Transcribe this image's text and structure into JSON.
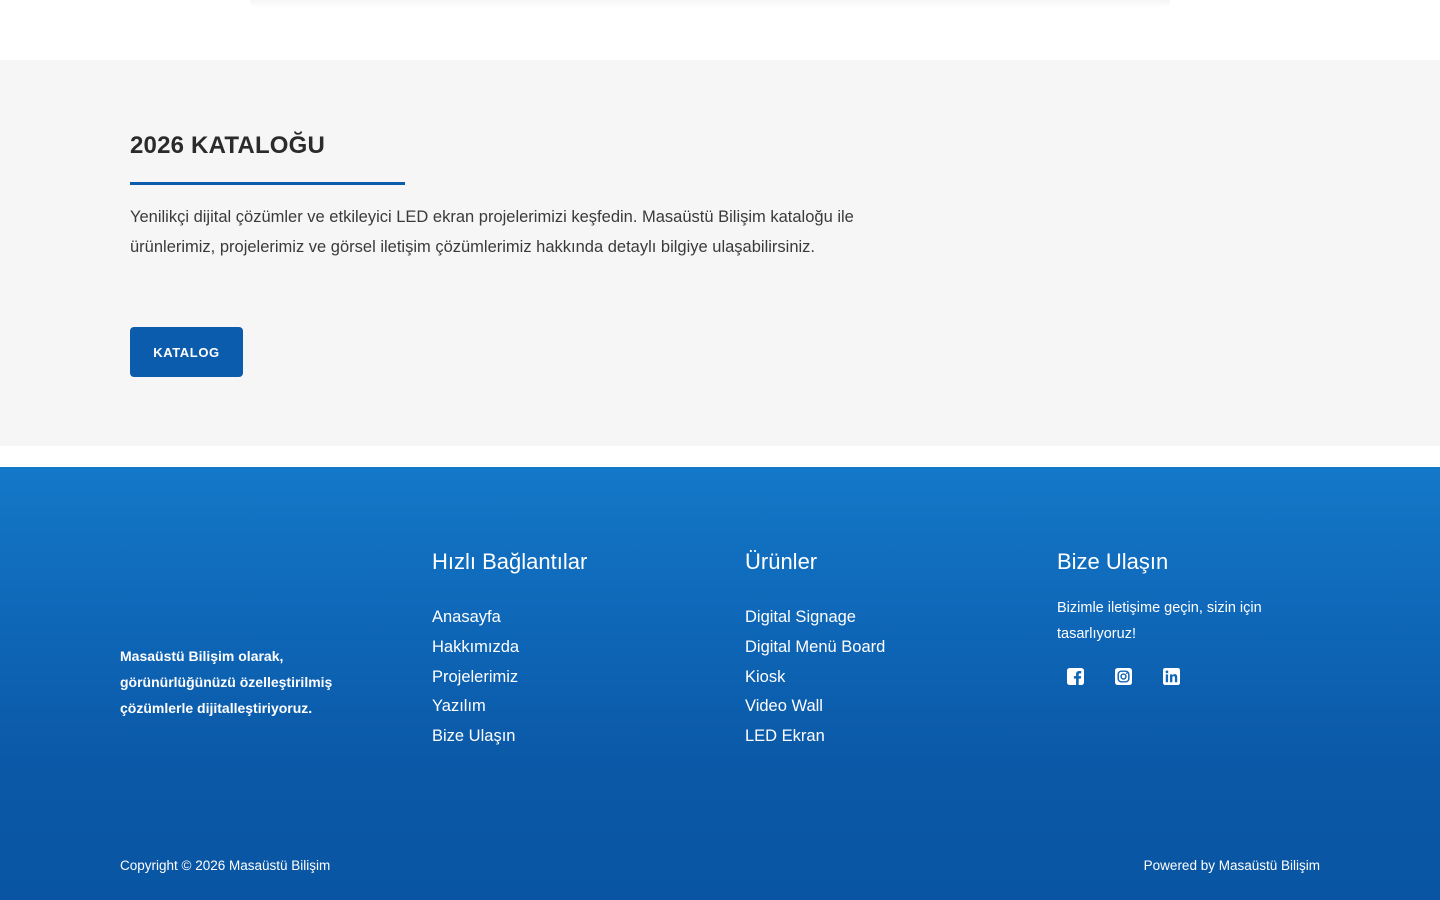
{
  "catalog": {
    "title": "2026 KATALOĞU",
    "description": "Yenilikçi dijital çözümler ve etkileyici LED ekran projelerimizi keşfedin. Masaüstü Bilişim kataloğu ile ürünlerimiz, projelerimiz ve görsel iletişim çözümlerimiz hakkında detaylı bilgiye ulaşabilirsiniz.",
    "button_label": "KATALOG",
    "accent_color": "#0b5cad"
  },
  "footer": {
    "about": "Masaüstü Bilişim olarak, görünürlüğünüzü özelleştirilmiş çözümlerle dijitalleştiriyoruz.",
    "quick_links": {
      "heading": "Hızlı Bağlantılar",
      "items": [
        "Anasayfa",
        "Hakkımızda",
        "Projelerimiz",
        "Yazılım",
        "Bize Ulaşın"
      ]
    },
    "products": {
      "heading": "Ürünler",
      "items": [
        "Digital Signage",
        "Digital Menü Board",
        "Kiosk",
        "Video Wall",
        "LED Ekran"
      ]
    },
    "contact": {
      "heading": "Bize Ulaşın",
      "text": "Bizimle iletişime geçin, sizin için tasarlıyoruz!",
      "social": [
        "facebook-icon",
        "instagram-icon",
        "linkedin-icon"
      ]
    },
    "copyright": "Copyright © 2026 Masaüstü Bilişim",
    "powered_by": "Powered by Masaüstü Bilişim",
    "gradient_top": "#1478c8",
    "gradient_bottom": "#0955a3"
  }
}
